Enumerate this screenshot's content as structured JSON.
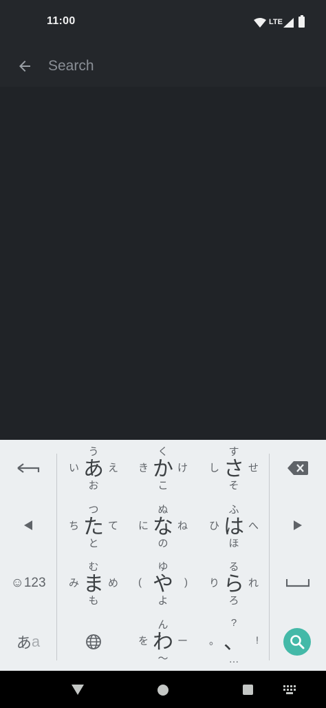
{
  "status": {
    "time": "11:00",
    "network": "LTE"
  },
  "icons": {
    "wifi": "wifi-icon",
    "signal": "signal-icon",
    "battery": "battery-icon",
    "back": "arrow-left-icon",
    "search": "search-icon",
    "globe": "globe-icon",
    "backspace": "backspace-icon",
    "undo": "undo-arrow-icon",
    "space": "space-icon"
  },
  "search": {
    "placeholder": "Search",
    "value": ""
  },
  "keyboard": {
    "left_keys": {
      "emoji_num": "☺123",
      "mode_kana": "あ",
      "mode_alpha": "a"
    },
    "kana": [
      {
        "c": "あ",
        "u": "う",
        "d": "お",
        "l": "い",
        "r": "え"
      },
      {
        "c": "か",
        "u": "く",
        "d": "こ",
        "l": "き",
        "r": "け"
      },
      {
        "c": "さ",
        "u": "す",
        "d": "そ",
        "l": "し",
        "r": "せ"
      },
      {
        "c": "た",
        "u": "つ",
        "d": "と",
        "l": "ち",
        "r": "て"
      },
      {
        "c": "な",
        "u": "ぬ",
        "d": "の",
        "l": "に",
        "r": "ね"
      },
      {
        "c": "は",
        "u": "ふ",
        "d": "ほ",
        "l": "ひ",
        "r": "へ"
      },
      {
        "c": "ま",
        "u": "む",
        "d": "も",
        "l": "み",
        "r": "め"
      },
      {
        "c": "や",
        "u": "ゆ",
        "d": "よ",
        "l": "(",
        "r": ")"
      },
      {
        "c": "ら",
        "u": "る",
        "d": "ろ",
        "l": "り",
        "r": "れ"
      },
      {
        "c": "わ",
        "u": "ん",
        "d": "〜",
        "l": "を",
        "r": "ー"
      },
      {
        "c": "、",
        "u": "?",
        "d": "…",
        "l": "。",
        "r": "!"
      }
    ]
  },
  "colors": {
    "accent": "#44b9a8",
    "background": "#202327",
    "bar": "#24272b",
    "keyboard": "#eceff1"
  }
}
